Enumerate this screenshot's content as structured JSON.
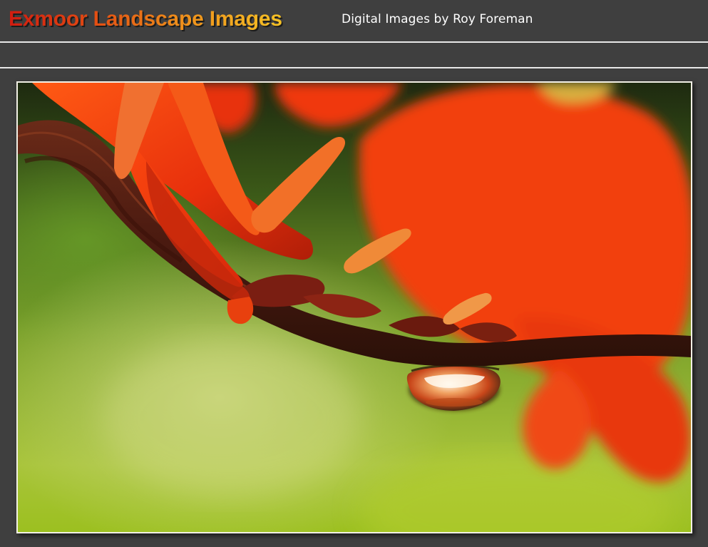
{
  "header": {
    "site_title": "Exmoor Landscape Images",
    "subtitle": "Digital Images by Roy Foreman"
  },
  "colors": {
    "page_background": "#3f3f3f",
    "title_gradient_start": "#d11c10",
    "title_gradient_end": "#f6c225",
    "rule_color": "#e8e8e8",
    "frame_border": "#f2f0e6",
    "subtitle_color": "#ffffff"
  },
  "photo": {
    "subject_icon": "red-flower-with-water-droplet-photo"
  }
}
